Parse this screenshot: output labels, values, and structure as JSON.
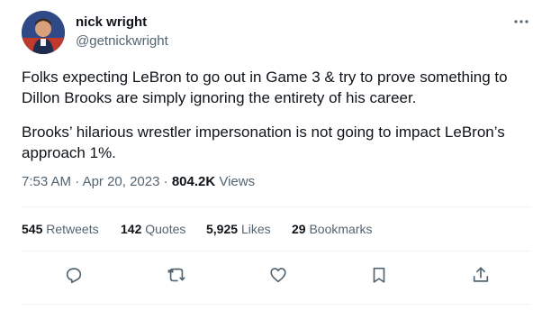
{
  "author": {
    "name": "nick wright",
    "handle": "@getnickwright"
  },
  "tweet": {
    "paragraph1": "Folks expecting LeBron to go out in Game 3 & try to prove something to Dillon Brooks are simply ignoring the entirety of his career.",
    "paragraph2": "Brooks’ hilarious wrestler impersonation is not going to impact LeBron’s approach 1%.",
    "time": "7:53 AM",
    "date": "Apr 20, 2023",
    "views_count": "804.2K",
    "views_label": "Views",
    "separator": "·"
  },
  "stats": {
    "retweets": {
      "count": "545",
      "label": "Retweets"
    },
    "quotes": {
      "count": "142",
      "label": "Quotes"
    },
    "likes": {
      "count": "5,925",
      "label": "Likes"
    },
    "bookmarks": {
      "count": "29",
      "label": "Bookmarks"
    }
  },
  "icons": {
    "more": "more-dots-icon",
    "reply": "reply-icon",
    "retweet": "retweet-icon",
    "like": "heart-icon",
    "bookmark": "bookmark-icon",
    "share": "share-icon"
  },
  "colors": {
    "text": "#0f1419",
    "secondary": "#536471",
    "divider": "#eff3f4"
  }
}
